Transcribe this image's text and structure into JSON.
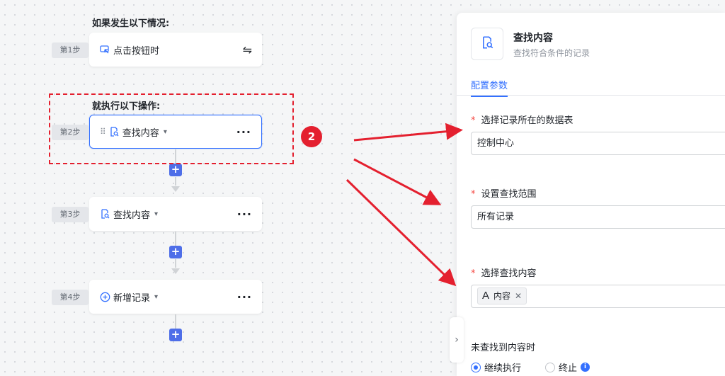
{
  "flow": {
    "trigger_title": "如果发生以下情况:",
    "action_title": "就执行以下操作:",
    "steps": [
      {
        "tag": "第1步",
        "label": "点击按钮时"
      },
      {
        "tag": "第2步",
        "label": "查找内容"
      },
      {
        "tag": "第3步",
        "label": "查找内容"
      },
      {
        "tag": "第4步",
        "label": "新增记录"
      }
    ],
    "more": "···",
    "plus": "+"
  },
  "annotation": {
    "badge": "2",
    "color": "#e4202f"
  },
  "panel": {
    "title": "查找内容",
    "subtitle": "查找符合条件的记录",
    "tab": "配置参数",
    "fields": [
      {
        "label": "选择记录所在的数据表",
        "value": "控制中心"
      },
      {
        "label": "设置查找范围",
        "value": "所有记录"
      },
      {
        "label": "选择查找内容",
        "chip": "内容"
      }
    ],
    "required_mark": "*",
    "not_found_label": "未查找到内容时",
    "options": [
      "继续执行",
      "终止"
    ],
    "selected_option": "继续执行"
  },
  "colors": {
    "accent": "#3370ff",
    "plus": "#4e6ee8"
  }
}
